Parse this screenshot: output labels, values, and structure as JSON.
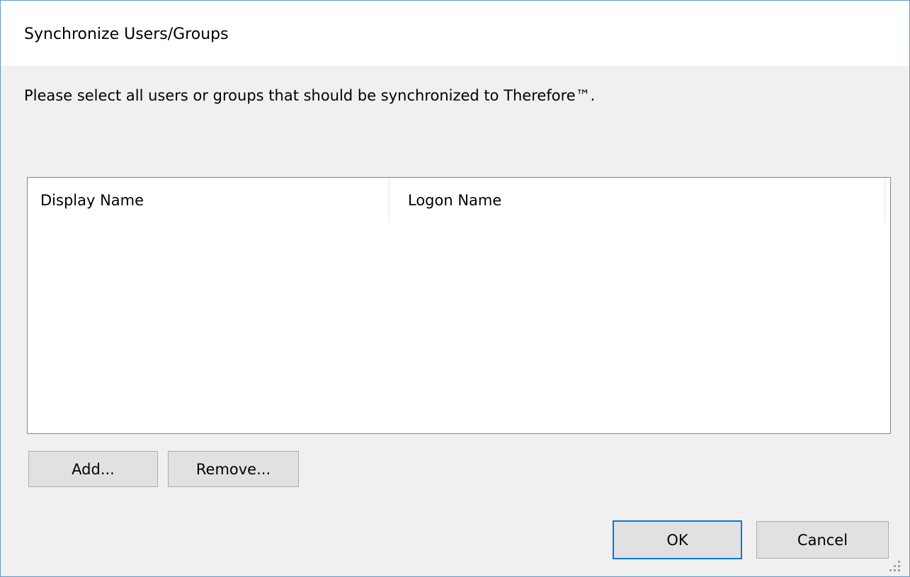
{
  "window": {
    "title": "Synchronize Users/Groups"
  },
  "instruction": "Please select all users or groups that should be synchronized to Therefore™.",
  "list": {
    "columns": [
      "Display Name",
      "Logon Name"
    ],
    "rows": []
  },
  "buttons": {
    "add": "Add...",
    "remove": "Remove...",
    "ok": "OK",
    "cancel": "Cancel"
  },
  "icons": {
    "resize_grip": "resize-grip-icon"
  },
  "colors": {
    "window_border": "#5b9bd5",
    "dialog_background": "#f0f0f0",
    "default_button_border": "#0078d7",
    "button_face": "#e1e1e1"
  }
}
